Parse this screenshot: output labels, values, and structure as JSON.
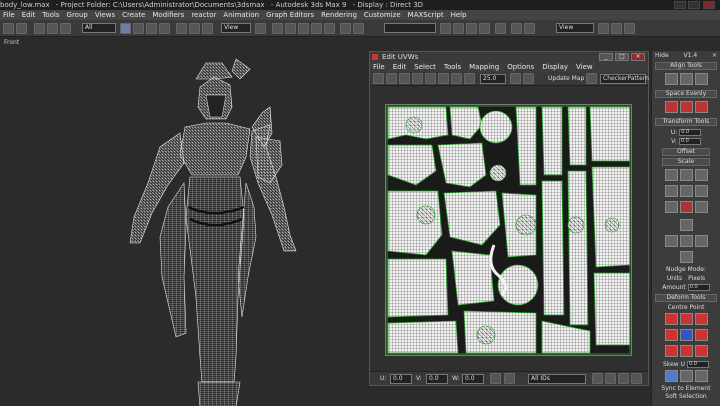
{
  "titlebar": {
    "file": "body_low.max",
    "project": "- Project Folder: C:\\Users\\Administrator\\Documents\\3dsmax",
    "app": "- Autodesk 3ds Max 9",
    "display": "- Display : Direct 3D"
  },
  "menubar": [
    "File",
    "Edit",
    "Tools",
    "Group",
    "Views",
    "Create",
    "Modifiers",
    "reactor",
    "Animation",
    "Graph Editors",
    "Rendering",
    "Customize",
    "MAXScript",
    "Help"
  ],
  "toolbar": {
    "selection_filter": "All",
    "ref_coord": "View",
    "named_sel": "",
    "view_drop": "View"
  },
  "viewport": {
    "label": "Front"
  },
  "uvw": {
    "title": "Edit UVWs",
    "menu": [
      "File",
      "Edit",
      "Select",
      "Tools",
      "Mapping",
      "Options",
      "Display",
      "View"
    ],
    "zoom_value": "25.0",
    "update_map": "Update Map",
    "checker": "CheckerPattern",
    "bottom": {
      "u_label": "U:",
      "v_label": "V:",
      "w_label": "W:",
      "u_val": "0.0",
      "v_val": "0.0",
      "w_val": "0.0",
      "ids": "All IDs"
    }
  },
  "panel": {
    "hide": "Hide",
    "version": "V1.4",
    "align": "Align Tools",
    "space": "Space Evenly",
    "transform": "Transform Tools",
    "u_label": "U:",
    "u_val": "0.0",
    "v_label": "V:",
    "v_val": "0.0",
    "offset": "Offset",
    "scale": "Scale",
    "nudge_mode": "Nudge Mode:",
    "units": "Units",
    "pixels": "Pixels",
    "amount_label": "Amount",
    "amount_val": "0.0",
    "deform": "Deform Tools",
    "centre": "Centre Point",
    "skew_label": "Skew U",
    "skew_val": "0.0",
    "sync": "Sync to Element",
    "soft": "Soft Selection"
  }
}
